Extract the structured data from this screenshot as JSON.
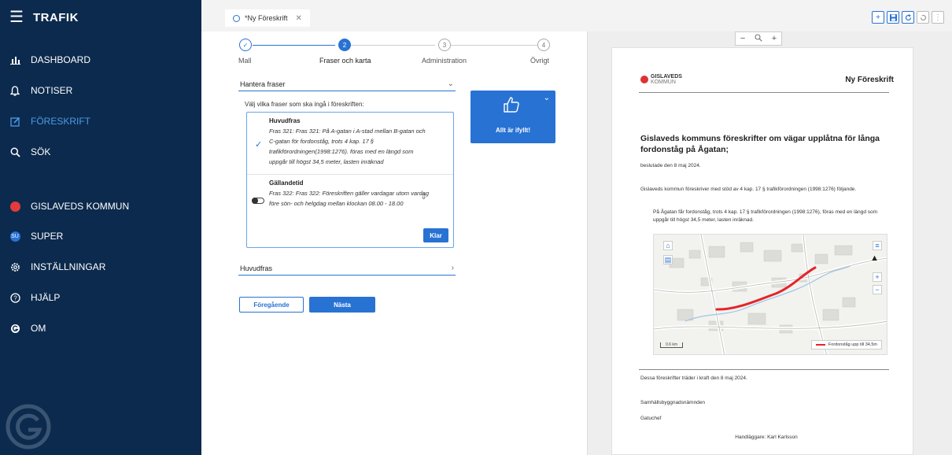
{
  "app": {
    "title": "TRAFIK"
  },
  "sidebar": {
    "items": [
      {
        "label": "DASHBOARD",
        "icon": "bar-chart-icon"
      },
      {
        "label": "NOTISER",
        "icon": "bell-icon"
      },
      {
        "label": "FÖRESKRIFT",
        "icon": "edit-icon",
        "active": true
      },
      {
        "label": "SÖK",
        "icon": "search-icon"
      },
      {
        "label": "GISLAVEDS KOMMUN",
        "icon": "municipality-icon"
      },
      {
        "label": "SUPER",
        "icon": "user-badge-icon",
        "badge": "Su"
      },
      {
        "label": "INSTÄLLNINGAR",
        "icon": "gear-icon"
      },
      {
        "label": "HJÄLP",
        "icon": "help-icon"
      },
      {
        "label": "OM",
        "icon": "about-icon"
      }
    ]
  },
  "tab": {
    "label": "*Ny Föreskrift"
  },
  "stepper": {
    "steps": [
      {
        "label": "Mall",
        "num": "✓",
        "state": "done"
      },
      {
        "label": "Fraser och karta",
        "num": "2",
        "state": "current"
      },
      {
        "label": "Administration",
        "num": "3",
        "state": "todo"
      },
      {
        "label": "Övrigt",
        "num": "4",
        "state": "todo"
      }
    ]
  },
  "form": {
    "select_phrases": "Hantera fraser",
    "hint": "Välj vilka fraser som ska ingå i föreskriften:",
    "phrases": [
      {
        "title": "Huvudfras",
        "text": "Fras 321: Fras 321: På A-gatan i A-stad mellan B-gatan och C-gatan för fordonståg, trots 4 kap. 17 § trafikförordningen(1998:1276). föras med en längd som uppgår till högst 34,5 meter, lasten inräknad"
      },
      {
        "title": "Gällandetid",
        "text": "Fras 322: Fras 322: Föreskriften gäller vardagar utom vardag före sön- och helgdag mellan klockan 08.00 - 18.00"
      }
    ],
    "done_button": "Klar",
    "main_phrase_select": "Huvudfras",
    "prev_button": "Föregående",
    "next_button": "Nästa"
  },
  "status_card": {
    "label": "Allt är ifyllt!"
  },
  "preview": {
    "logo_name": "GISLAVEDS",
    "logo_sub": "KOMMUN",
    "doc_title": "Ny Föreskrift",
    "heading": "Gislaveds kommuns föreskrifter om vägar upplåtna för långa fordonståg på Ågatan;",
    "decided": "beslutade den 8 maj 2024.",
    "para1": "Gislaveds kommun föreskriver med stöd av 4 kap. 17 § trafikförordningen (1998:1276) följande.",
    "para2": "På Ågatan får fordonståg, trots 4 kap. 17 § trafikförordningen (1998:1276), föras med en längd som uppgår till högst 34,5 meter, lasten inräknad.",
    "map_legend": "Fordonståg upp till 34,5m",
    "map_scale": "0.6 km",
    "effective": "Dessa föreskrifter träder i kraft den 8 maj 2024.",
    "board": "Samhällsbyggnadsnämnden",
    "role": "Gatuchef",
    "handler": "Handläggare: Karl Karlsson"
  },
  "colors": {
    "sidebar": "#0c2a4d",
    "accent": "#2872d4",
    "route": "#e4242b"
  }
}
